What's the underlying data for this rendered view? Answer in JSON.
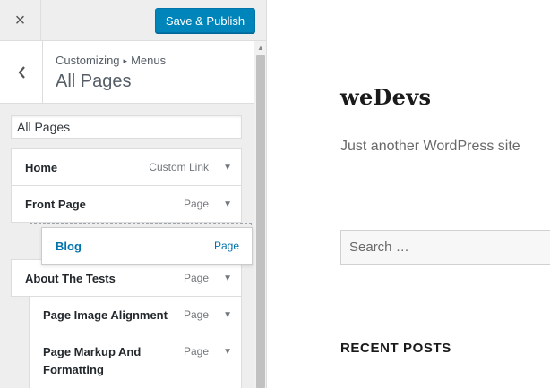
{
  "sidebar": {
    "close_label": "×",
    "publish_label": "Save & Publish",
    "back_label": "‹",
    "breadcrumb": {
      "parent": "Customizing",
      "child": "Menus",
      "separator": "▸"
    },
    "title": "All Pages",
    "menu_name_value": "All Pages",
    "menu_items": [
      {
        "title": "Home",
        "type": "Custom Link"
      },
      {
        "title": "Front Page",
        "type": "Page"
      },
      {
        "title": "About The Tests",
        "type": "Page"
      },
      {
        "title": "Page Image Alignment",
        "type": "Page"
      },
      {
        "title": "Page Markup And",
        "title_line2": "Formatting",
        "type": "Page"
      }
    ],
    "dragging_item": {
      "title": "Blog",
      "type": "Page"
    },
    "toggle_glyph": "▼"
  },
  "preview": {
    "site_title": "weDevs",
    "tagline": "Just another WordPress site",
    "search_placeholder": "Search …",
    "recent_posts_heading": "RECENT POSTS"
  },
  "colors": {
    "accent": "#0085ba",
    "sidebar_bg": "#eeeeee",
    "link_blue": "#0073aa"
  }
}
